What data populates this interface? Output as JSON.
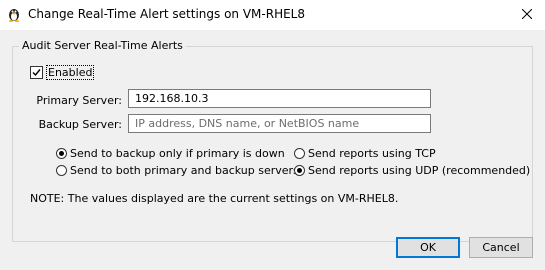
{
  "window": {
    "title": "Change Real-Time Alert settings on VM-RHEL8"
  },
  "group": {
    "title": "Audit Server Real-Time Alerts",
    "enabled_label": "Enabled",
    "enabled_checked": true
  },
  "primary_server": {
    "label": "Primary Server:",
    "value": "192.168.10.3"
  },
  "backup_server": {
    "label": "Backup Server:",
    "value": "",
    "placeholder": "IP address, DNS name, or NetBIOS name"
  },
  "send_mode": {
    "backup_only_label": "Send to backup only if primary is down",
    "both_label": "Send to both primary and backup servers",
    "selected": "backup_only"
  },
  "protocol": {
    "tcp_label": "Send reports using TCP",
    "udp_label": "Send reports using UDP (recommended)",
    "selected": "udp"
  },
  "note": "NOTE: The values displayed are the current settings on VM-RHEL8.",
  "buttons": {
    "ok": "OK",
    "cancel": "Cancel"
  }
}
